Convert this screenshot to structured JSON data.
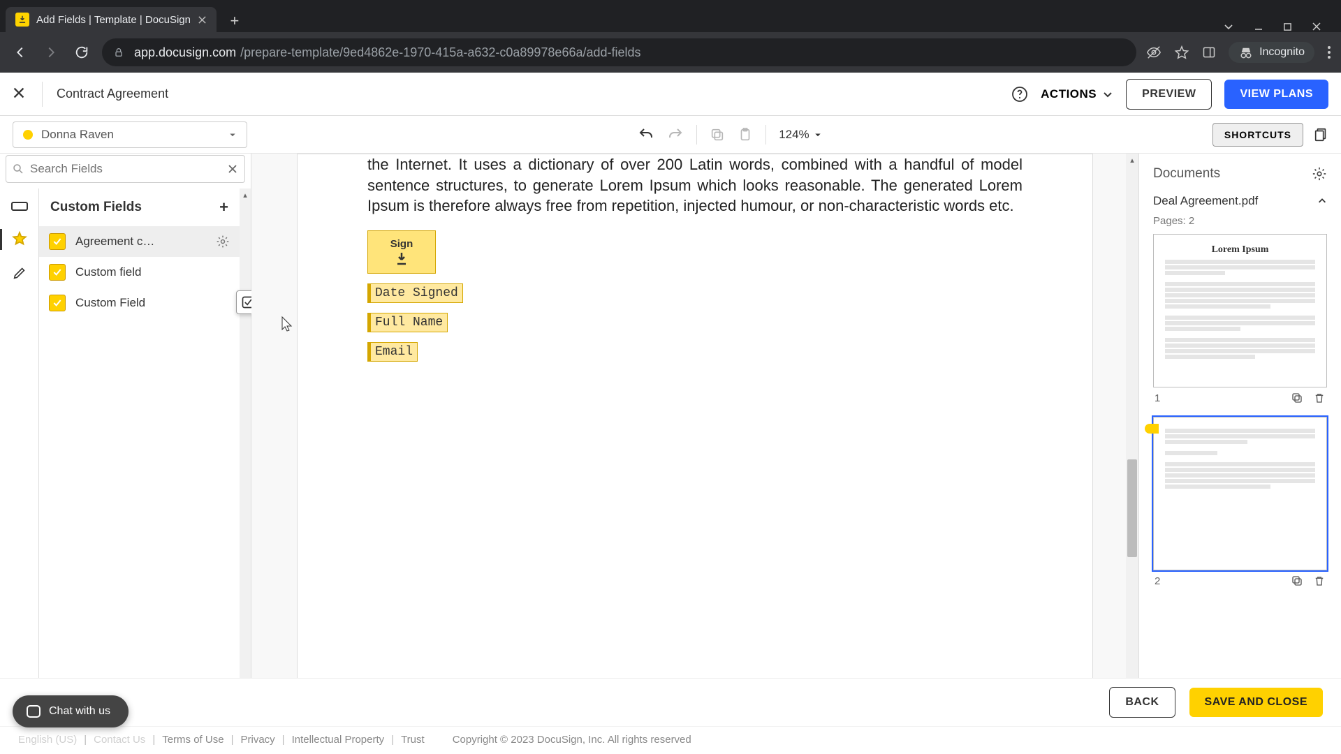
{
  "browser": {
    "tab_title": "Add Fields | Template | DocuSign",
    "url_host": "app.docusign.com",
    "url_path": "/prepare-template/9ed4862e-1970-415a-a632-c0a89978e66a/add-fields",
    "incognito_label": "Incognito"
  },
  "header": {
    "title": "Contract Agreement",
    "actions_label": "ACTIONS",
    "preview_label": "PREVIEW",
    "view_plans_label": "VIEW PLANS"
  },
  "toolbar": {
    "recipient": "Donna Raven",
    "zoom": "124%",
    "shortcuts_label": "SHORTCUTS"
  },
  "search": {
    "placeholder": "Search Fields"
  },
  "fields_panel": {
    "title": "Custom Fields",
    "items": [
      {
        "label": "Agreement c…"
      },
      {
        "label": "Custom field"
      },
      {
        "label": "Custom Field"
      }
    ]
  },
  "canvas": {
    "body_text": "the Internet. It uses a dictionary of over 200 Latin words, combined with a handful of model sentence structures, to generate Lorem Ipsum which looks reasonable. The generated Lorem Ipsum is therefore always free from repetition, injected humour, or non-characteristic words etc.",
    "sign_label": "Sign",
    "date_signed": "Date Signed",
    "full_name": "Full Name",
    "email": "Email"
  },
  "documents": {
    "title": "Documents",
    "file_name": "Deal Agreement.pdf",
    "pages_label": "Pages: 2",
    "thumb1_title": "Lorem Ipsum",
    "page1_num": "1",
    "page2_num": "2"
  },
  "footer": {
    "back": "BACK",
    "save": "SAVE AND CLOSE",
    "links": [
      "English (US)",
      "Contact Us",
      "Terms of Use",
      "Privacy",
      "Intellectual Property",
      "Trust"
    ],
    "copyright": "Copyright © 2023 DocuSign, Inc. All rights reserved"
  },
  "chat": {
    "label": "Chat with us"
  }
}
